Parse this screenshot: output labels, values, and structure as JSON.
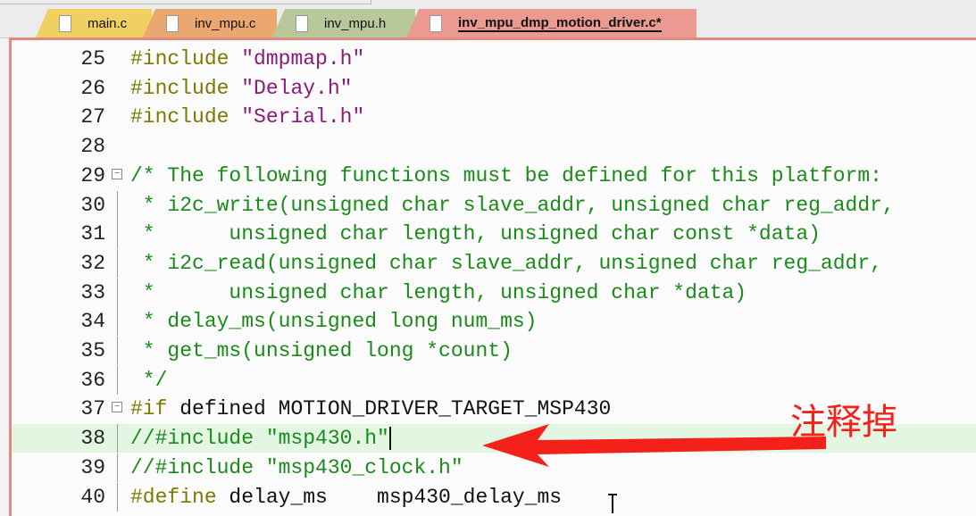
{
  "tabs": [
    {
      "label": "main.c",
      "color": "#f0d060"
    },
    {
      "label": "inv_mpu.c",
      "color": "#eaa870"
    },
    {
      "label": "inv_mpu.h",
      "color": "#b8c89a"
    },
    {
      "label": "inv_mpu_dmp_motion_driver.c*",
      "color": "#ea9a90",
      "active": true
    }
  ],
  "lines": [
    {
      "n": "25",
      "seg": [
        [
          "pp",
          "#include "
        ],
        [
          "str",
          "\"dmpmap.h\""
        ]
      ]
    },
    {
      "n": "26",
      "seg": [
        [
          "pp",
          "#include "
        ],
        [
          "str",
          "\"Delay.h\""
        ]
      ]
    },
    {
      "n": "27",
      "seg": [
        [
          "pp",
          "#include "
        ],
        [
          "str",
          "\"Serial.h\""
        ]
      ]
    },
    {
      "n": "28",
      "seg": []
    },
    {
      "n": "29",
      "fold": true,
      "seg": [
        [
          "cm",
          "/* The following functions must be defined for this platform:"
        ]
      ]
    },
    {
      "n": "30",
      "seg": [
        [
          "cm",
          " * i2c_write(unsigned char slave_addr, unsigned char reg_addr,"
        ]
      ]
    },
    {
      "n": "31",
      "seg": [
        [
          "cm",
          " *      unsigned char length, unsigned char const *data)"
        ]
      ]
    },
    {
      "n": "32",
      "seg": [
        [
          "cm",
          " * i2c_read(unsigned char slave_addr, unsigned char reg_addr,"
        ]
      ]
    },
    {
      "n": "33",
      "seg": [
        [
          "cm",
          " *      unsigned char length, unsigned char *data)"
        ]
      ]
    },
    {
      "n": "34",
      "seg": [
        [
          "cm",
          " * delay_ms(unsigned long num_ms)"
        ]
      ]
    },
    {
      "n": "35",
      "seg": [
        [
          "cm",
          " * get_ms(unsigned long *count)"
        ]
      ]
    },
    {
      "n": "36",
      "seg": [
        [
          "cm",
          " */"
        ]
      ]
    },
    {
      "n": "37",
      "fold": true,
      "seg": [
        [
          "pp",
          "#if "
        ],
        [
          "pl",
          "defined MOTION_DRIVER_TARGET_MSP430"
        ]
      ]
    },
    {
      "n": "38",
      "hl": true,
      "caret": true,
      "seg": [
        [
          "cm",
          "//#include \"msp430.h\""
        ]
      ]
    },
    {
      "n": "39",
      "seg": [
        [
          "cm",
          "//#include \"msp430_clock.h\""
        ]
      ]
    },
    {
      "n": "40",
      "seg": [
        [
          "pp",
          "#define "
        ],
        [
          "pl",
          "delay_ms    msp430_delay_ms"
        ]
      ]
    }
  ],
  "annotation": "注释掉",
  "annotation_color": "#f4201a"
}
